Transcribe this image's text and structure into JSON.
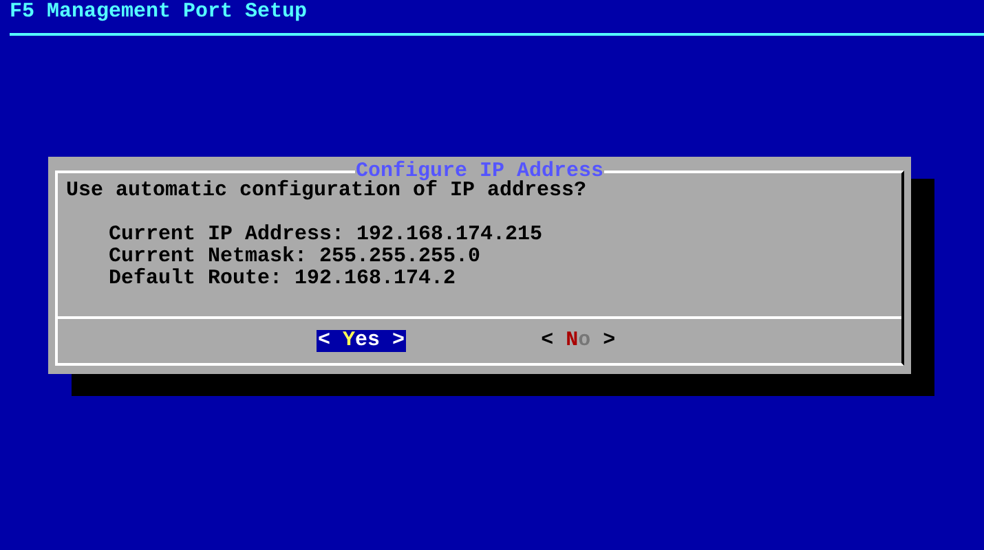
{
  "screen": {
    "title": "F5 Management Port Setup"
  },
  "dialog": {
    "title": "Configure IP Address",
    "question": "Use automatic configuration of IP address?",
    "details": [
      "Current IP Address: 192.168.174.215",
      "Current Netmask: 255.255.255.0",
      "Default Route: 192.168.174.2"
    ],
    "buttons": [
      {
        "open": "<",
        "label": "Yes",
        "close": ">",
        "selected": true
      },
      {
        "open": "<",
        "label": "No",
        "close": ">",
        "selected": false
      }
    ]
  }
}
